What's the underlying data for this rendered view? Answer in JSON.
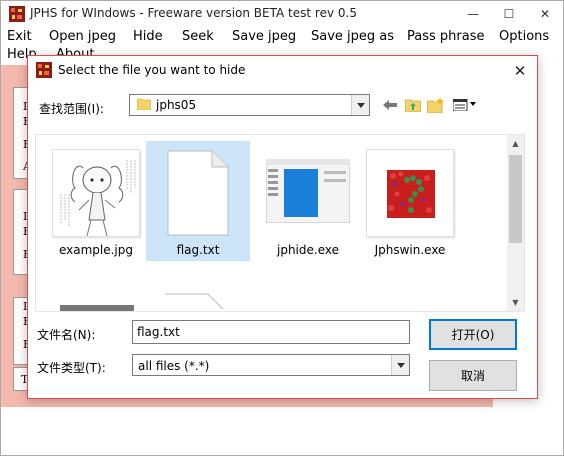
{
  "app": {
    "title": "JPHS for WIndows - Freeware version BETA test rev 0.5",
    "controls": {
      "minimize": "—",
      "maximize": "☐",
      "close": "✕"
    }
  },
  "menu": {
    "items": [
      "Exit",
      "Open jpeg",
      "Hide",
      "Seek",
      "Save jpeg",
      "Save jpeg as",
      "Pass phrase",
      "Options"
    ],
    "row2": [
      "Help",
      "About"
    ]
  },
  "background_letters": [
    "I",
    "F",
    "E",
    "A",
    "I",
    "F",
    "E",
    "I",
    "F",
    "E",
    "T"
  ],
  "dialog": {
    "title": "Select the file you want to hide",
    "close": "✕",
    "look_in_label": "查找范围(I):",
    "look_in_value": "jphs05",
    "files": [
      {
        "name": "example.jpg",
        "type": "image-anime"
      },
      {
        "name": "flag.txt",
        "type": "text-doc",
        "selected": true
      },
      {
        "name": "jphide.exe",
        "type": "app-window"
      },
      {
        "name": "Jphswin.exe",
        "type": "ishihara-image"
      }
    ],
    "filename_label": "文件名(N):",
    "filename_value": "flag.txt",
    "filetype_label": "文件类型(T):",
    "filetype_value": "all files (*.*)",
    "open_button": "打开(O)",
    "cancel_button": "取消"
  },
  "colors": {
    "accent": "#0078d7",
    "selection": "#cce4f7",
    "dialog_border": "#e04a4a",
    "panel": "#f4b8ac"
  }
}
